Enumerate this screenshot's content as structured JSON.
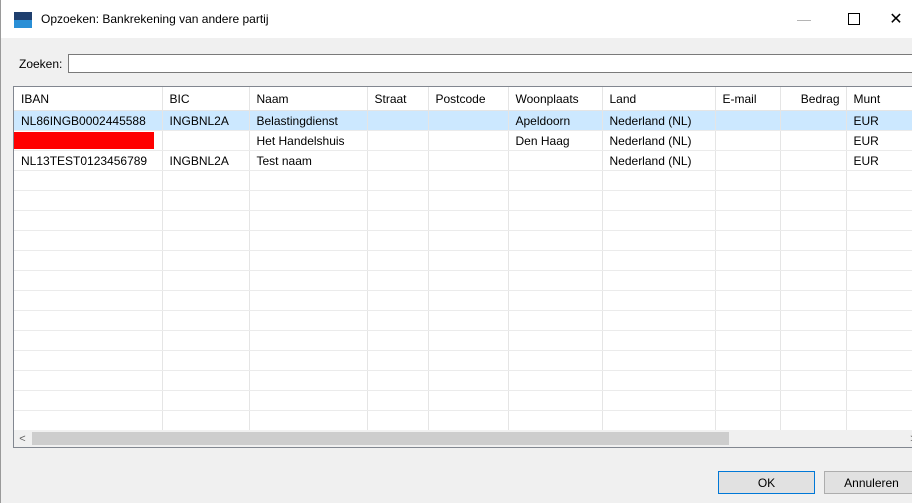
{
  "window": {
    "title": "Opzoeken: Bankrekening van andere partij",
    "minimize_glyph": "—",
    "close_glyph": "✕"
  },
  "search": {
    "label": "Zoeken:",
    "value": ""
  },
  "table": {
    "columns": [
      "IBAN",
      "BIC",
      "Naam",
      "Straat",
      "Postcode",
      "Woonplaats",
      "Land",
      "E-mail",
      "Bedrag",
      "Munt"
    ],
    "rows": [
      {
        "iban": "NL86INGB0002445588",
        "bic": "INGBNL2A",
        "naam": "Belastingdienst",
        "straat": "",
        "postcode": "",
        "woonplaats": "Apeldoorn",
        "land": "Nederland (NL)",
        "email": "",
        "bedrag": "",
        "munt": "EUR",
        "selected": true
      },
      {
        "iban": "",
        "bic": "",
        "naam": "Het Handelshuis",
        "straat": "",
        "postcode": "",
        "woonplaats": "Den Haag",
        "land": "Nederland (NL)",
        "email": "",
        "bedrag": "",
        "munt": "EUR",
        "iban_redacted": true
      },
      {
        "iban": "NL13TEST0123456789",
        "bic": "INGBNL2A",
        "naam": "Test naam",
        "straat": "",
        "postcode": "",
        "woonplaats": "",
        "land": "Nederland (NL)",
        "email": "",
        "bedrag": "",
        "munt": "EUR"
      }
    ]
  },
  "scrollbar": {
    "left_arrow": "<",
    "right_arrow": ">"
  },
  "buttons": {
    "ok": "OK",
    "cancel": "Annuleren"
  },
  "colors": {
    "selection": "#cce8ff",
    "redaction": "#ff0000",
    "icon_dark": "#1f3f6e",
    "icon_light": "#2a8fd6",
    "ok_border": "#0078d7"
  }
}
